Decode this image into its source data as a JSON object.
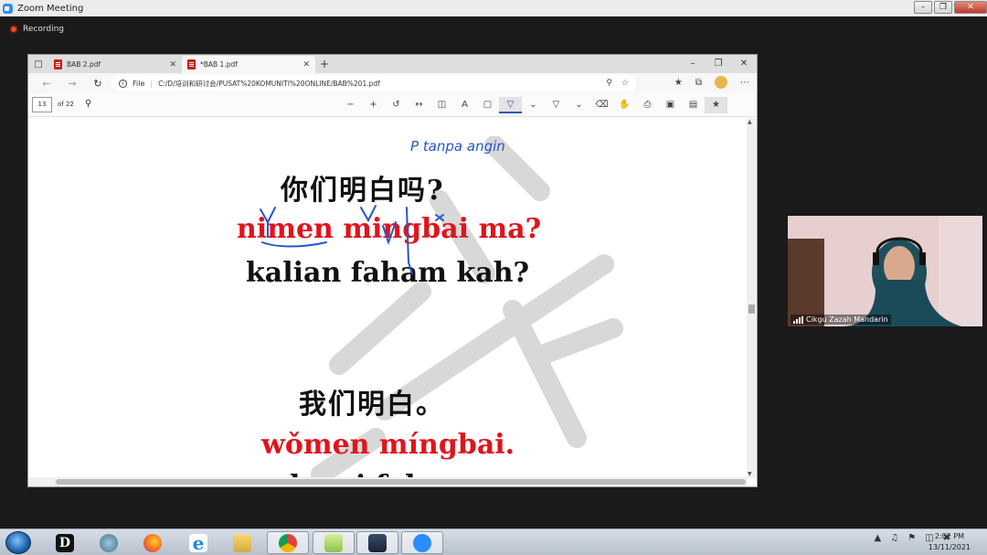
{
  "zoom": {
    "window_title": "Zoom Meeting",
    "recording_label": "Recording",
    "participant_name": "Cikgu Zazah Mandarin"
  },
  "browser": {
    "tabs": [
      {
        "label": "BAB 2.pdf",
        "active": false
      },
      {
        "label": "*BAB 1.pdf",
        "active": true
      }
    ],
    "address": {
      "file_label": "File",
      "url": "C:/D/培训和研讨会/PUSAT%20KOMUNITI%20ONLINE/BAB%201.pdf"
    },
    "pdf_toolbar": {
      "current_page": "13",
      "total_pages": "of 22"
    }
  },
  "pdf_page": {
    "line1_zh": "你们明白吗?",
    "line1_pinyin": "nimen mingbai ma?",
    "line1_malay": "kalian faham kah?",
    "line2_zh": "我们明白。",
    "line2_pinyin": "wǒmen míngbai.",
    "line2_malay_partial": "kami faham",
    "handwritten_note": "P tanpa angin"
  },
  "taskbar": {
    "time": "2:02 PM",
    "date": "13/11/2021"
  },
  "colors": {
    "pinyin_red": "#e0141c",
    "annotation_blue": "#2456c8",
    "zoom_blue": "#2d8cff"
  }
}
